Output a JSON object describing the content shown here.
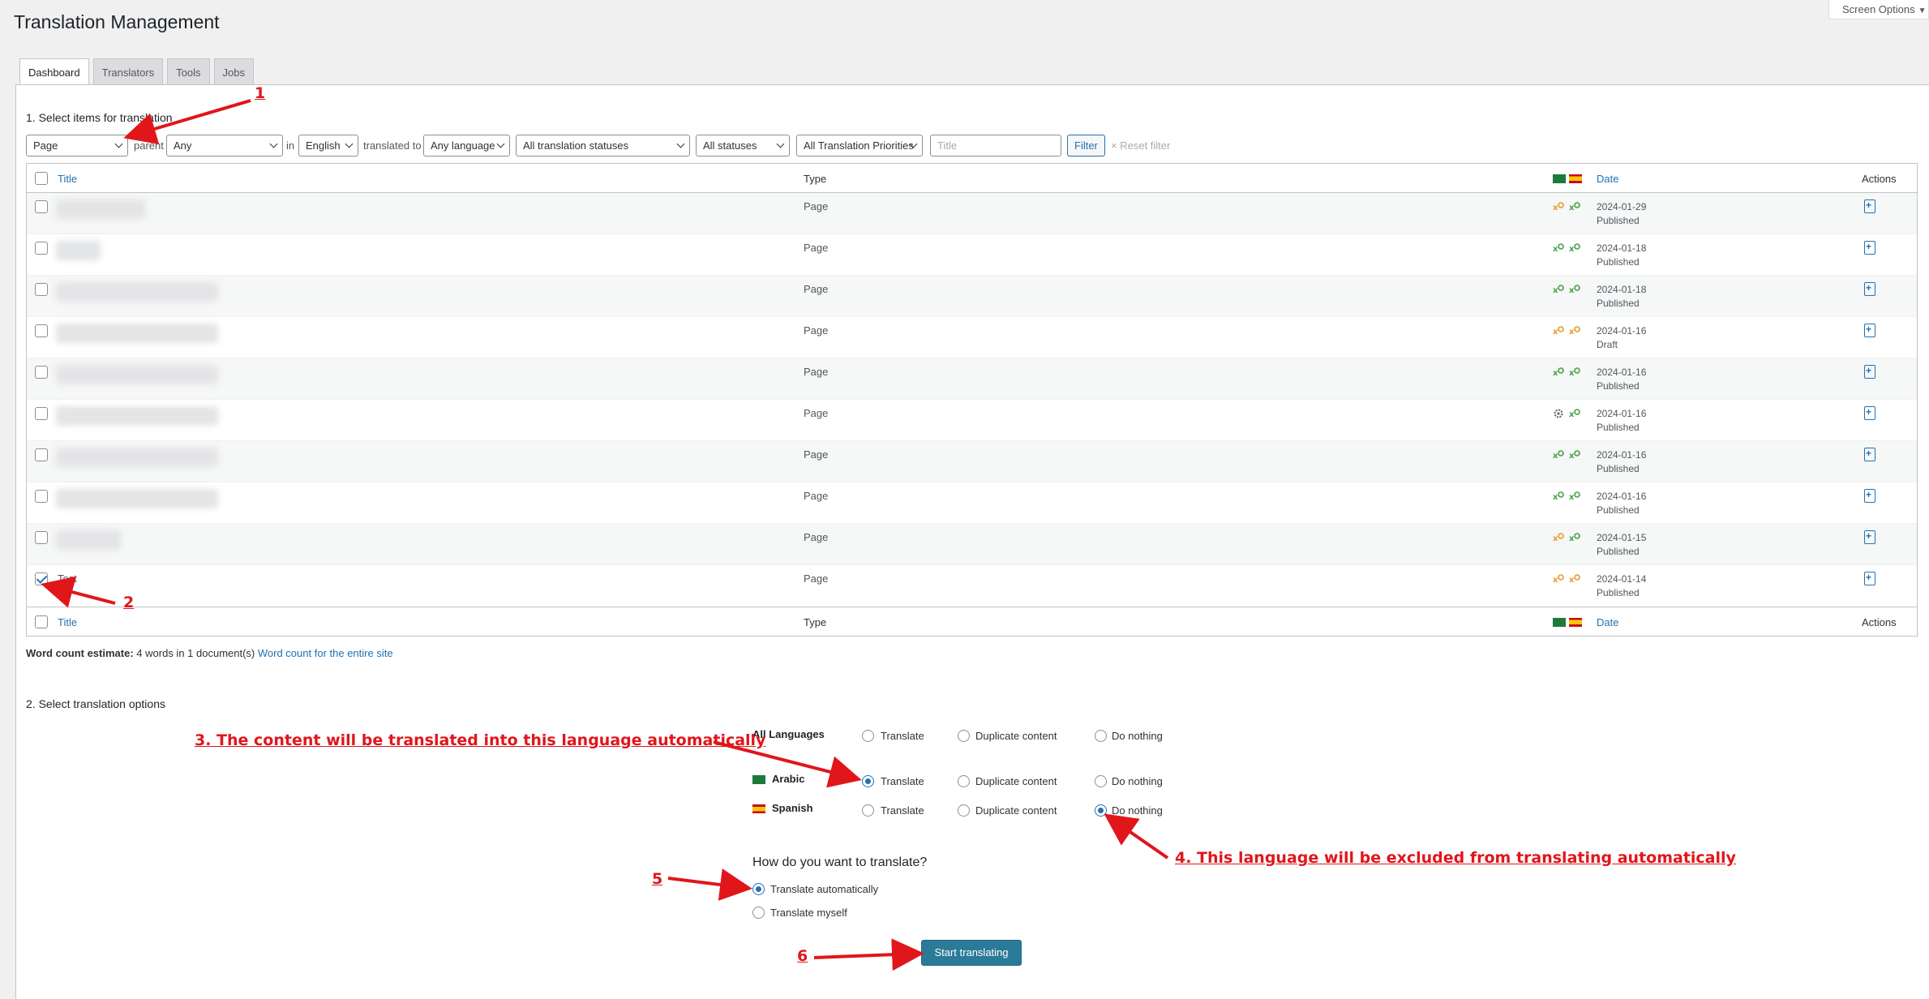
{
  "page": {
    "title": "Translation Management",
    "screen_options": "Screen Options"
  },
  "tabs": [
    {
      "label": "Dashboard",
      "active": true
    },
    {
      "label": "Translators"
    },
    {
      "label": "Tools"
    },
    {
      "label": "Jobs"
    }
  ],
  "section1": {
    "title": "1. Select items for translation",
    "filters": {
      "type": "Page",
      "parent_label": "parent",
      "parent": "Any",
      "in_label": "in",
      "language": "English",
      "translated_to_label": "translated to",
      "target": "Any language",
      "translation_status": "All translation statuses",
      "status": "All statuses",
      "priority": "All Translation Priorities",
      "title_placeholder": "Title",
      "filter_button": "Filter",
      "reset": "Reset filter"
    }
  },
  "table": {
    "columns": {
      "title": "Title",
      "type": "Type",
      "date": "Date",
      "actions": "Actions"
    },
    "rows": [
      {
        "title": "",
        "type": "Page",
        "date": "2024-01-29",
        "status": "Published",
        "checked": false,
        "langs": [
          "needs-update",
          "complete"
        ]
      },
      {
        "title": "",
        "type": "Page",
        "date": "2024-01-18",
        "status": "Published",
        "checked": false,
        "langs": [
          "complete",
          "complete"
        ]
      },
      {
        "title": "",
        "type": "Page",
        "date": "2024-01-18",
        "status": "Published",
        "checked": false,
        "langs": [
          "complete",
          "complete"
        ]
      },
      {
        "title": "",
        "type": "Page",
        "date": "2024-01-16",
        "status": "Draft",
        "checked": false,
        "langs": [
          "needs-update",
          "needs-update"
        ]
      },
      {
        "title": "",
        "type": "Page",
        "date": "2024-01-16",
        "status": "Published",
        "checked": false,
        "langs": [
          "complete",
          "complete"
        ]
      },
      {
        "title": "",
        "type": "Page",
        "date": "2024-01-16",
        "status": "Published",
        "checked": false,
        "langs": [
          "in-progress",
          "complete"
        ]
      },
      {
        "title": "",
        "type": "Page",
        "date": "2024-01-16",
        "status": "Published",
        "checked": false,
        "langs": [
          "complete",
          "complete"
        ]
      },
      {
        "title": "",
        "type": "Page",
        "date": "2024-01-16",
        "status": "Published",
        "checked": false,
        "langs": [
          "complete",
          "complete"
        ]
      },
      {
        "title": "",
        "type": "Page",
        "date": "2024-01-15",
        "status": "Published",
        "checked": false,
        "langs": [
          "needs-update",
          "complete"
        ]
      },
      {
        "title": "Test",
        "type": "Page",
        "date": "2024-01-14",
        "status": "Published",
        "checked": true,
        "langs": [
          "needs-update",
          "needs-update"
        ]
      }
    ]
  },
  "word_count": {
    "label": "Word count estimate:",
    "value": "4 words in 1 document(s)",
    "link": "Word count for the entire site"
  },
  "section2": {
    "title": "2. Select translation options",
    "options": {
      "translate": "Translate",
      "duplicate": "Duplicate content",
      "nothing": "Do nothing"
    },
    "languages": [
      {
        "name": "All Languages",
        "selected": null
      },
      {
        "name": "Arabic",
        "selected": "translate"
      },
      {
        "name": "Spanish",
        "selected": "nothing"
      }
    ],
    "how_title": "How do you want to translate?",
    "how_options": [
      "Translate automatically",
      "Translate myself"
    ],
    "how_selected": 0,
    "start_button": "Start translating"
  },
  "annotations": {
    "a1": "1",
    "a2": "2",
    "a3": "3. The content will be translated into this language automatically",
    "a4": "4. This language will be excluded from translating automatically",
    "a5": "5",
    "a6": "6"
  },
  "colors": {
    "accent": "#2271b1",
    "button": "#2b7a98",
    "annotation": "#e0161b",
    "status_complete": "#46a047",
    "status_needs_update": "#e69a28"
  }
}
